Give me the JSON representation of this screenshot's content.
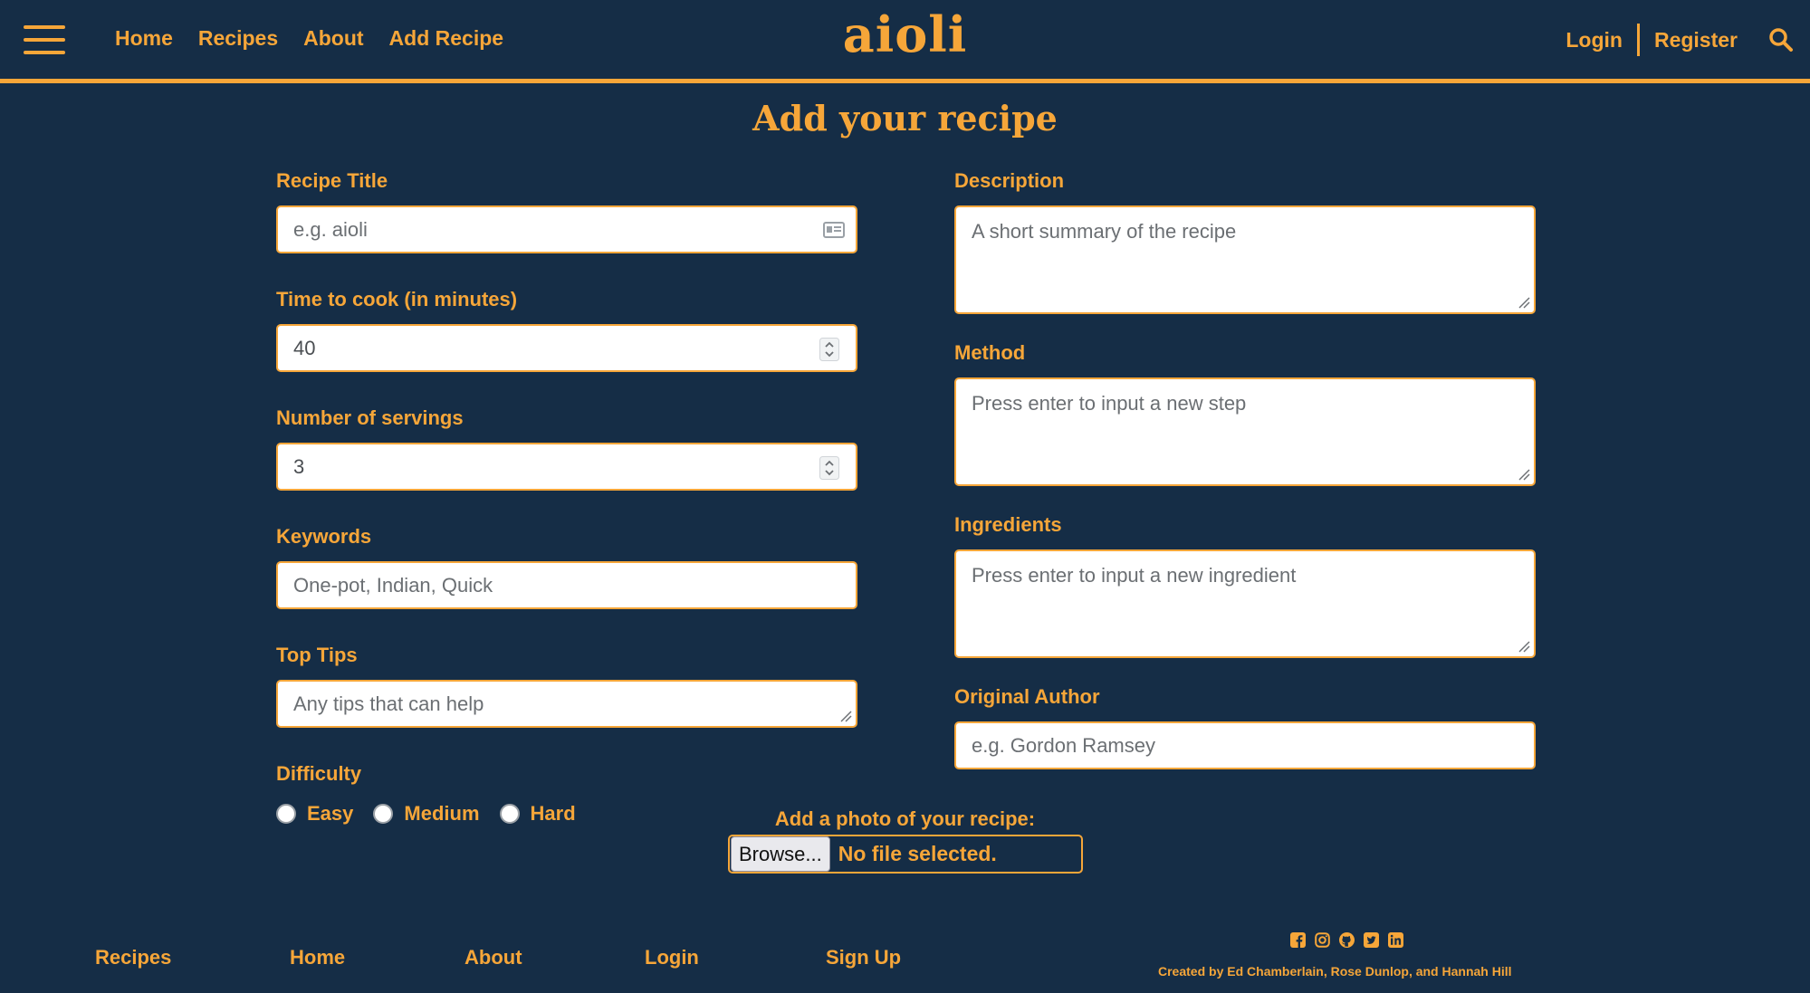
{
  "brand": "aioli",
  "nav": {
    "left": [
      "Home",
      "Recipes",
      "About",
      "Add Recipe"
    ],
    "login": "Login",
    "register": "Register"
  },
  "page_title": "Add your recipe",
  "form": {
    "recipe_title": {
      "label": "Recipe Title",
      "placeholder": "e.g. aioli"
    },
    "time_to_cook": {
      "label": "Time to cook (in minutes)",
      "value": "40"
    },
    "servings": {
      "label": "Number of servings",
      "value": "3"
    },
    "keywords": {
      "label": "Keywords",
      "placeholder": "One-pot, Indian, Quick"
    },
    "top_tips": {
      "label": "Top Tips",
      "placeholder": "Any tips that can help"
    },
    "difficulty": {
      "label": "Difficulty",
      "options": [
        "Easy",
        "Medium",
        "Hard"
      ]
    },
    "description": {
      "label": "Description",
      "placeholder": "A short summary of the recipe"
    },
    "method": {
      "label": "Method",
      "placeholder": "Press enter to input a new step"
    },
    "ingredients": {
      "label": "Ingredients",
      "placeholder": "Press enter to input a new ingredient"
    },
    "original_author": {
      "label": "Original Author",
      "placeholder": "e.g. Gordon Ramsey"
    }
  },
  "photo": {
    "label": "Add a photo of your recipe:",
    "browse": "Browse...",
    "status": "No file selected."
  },
  "footer": {
    "links": [
      "Recipes",
      "Home",
      "About",
      "Login",
      "Sign Up"
    ],
    "socials": [
      "facebook-icon",
      "instagram-icon",
      "github-icon",
      "twitter-icon",
      "linkedin-icon"
    ],
    "credit": "Created by Ed Chamberlain, Rose Dunlop, and Hannah Hill"
  },
  "colors": {
    "background": "#152d46",
    "accent": "#f6a639",
    "field": "#ffffff"
  }
}
